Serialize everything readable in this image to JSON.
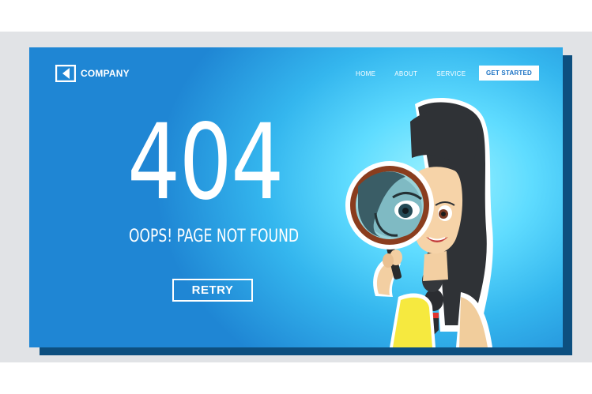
{
  "logo": {
    "text": "COMPANY"
  },
  "nav": {
    "items": [
      "HOME",
      "ABOUT",
      "SERVICE"
    ],
    "cta_label": "GET STARTED"
  },
  "error": {
    "code": "404",
    "message": "OOPS! PAGE NOT FOUND"
  },
  "retry_label": "RETRY",
  "colors": {
    "background_gradient": [
      "#9ff3ff",
      "#34b6ee",
      "#1f86d4"
    ],
    "shadow_panel": "#0d4f7f",
    "text": "#ffffff",
    "cta_text": "#1a72c4"
  },
  "illustration": {
    "subject": "girl-with-magnifying-glass",
    "icon": "magnifying-glass-icon"
  }
}
